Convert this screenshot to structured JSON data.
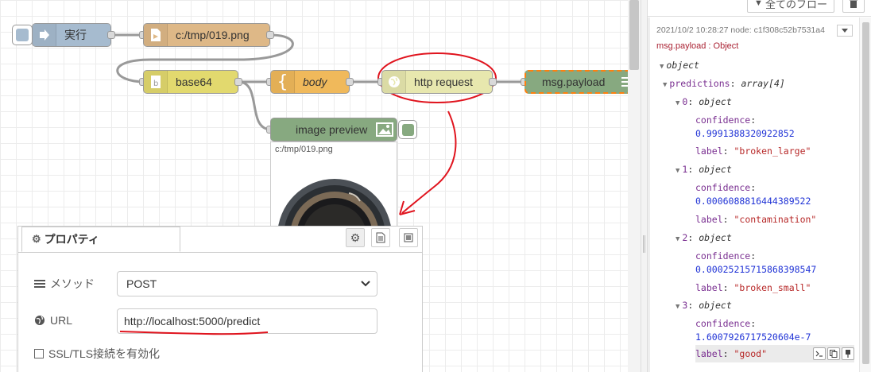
{
  "flow": {
    "inject": {
      "label": "実行"
    },
    "file_in": {
      "label": "c:/tmp/019.png"
    },
    "base64": {
      "label": "base64"
    },
    "template": {
      "label": "body"
    },
    "http": {
      "label": "http request"
    },
    "debug": {
      "label": "msg.payload"
    },
    "preview": {
      "label": "image preview",
      "caption": "c:/tmp/019.png"
    }
  },
  "properties": {
    "tab_title": "プロパティ",
    "method_label": "メソッド",
    "method_value": "POST",
    "url_label": "URL",
    "url_value": "http://localhost:5000/predict",
    "ssl_label": "SSL/TLS接続を有効化"
  },
  "sidebar": {
    "filter_label": "全てのフロー",
    "meta": "2021/10/2 10:28:27   node: c1f308c52b7531a4",
    "topic": "msg.payload : Object",
    "tree": {
      "root": "object",
      "predictions_key": "predictions",
      "predictions_type": "array[4]",
      "items": [
        {
          "index": "0",
          "type": "object",
          "confidence": "0.9991388320922852",
          "label": "\"broken_large\""
        },
        {
          "index": "1",
          "type": "object",
          "confidence": "0.0006088816444389522",
          "label": "\"contamination\""
        },
        {
          "index": "2",
          "type": "object",
          "confidence": "0.00025215715868398547",
          "label": "\"broken_small\""
        },
        {
          "index": "3",
          "type": "object",
          "confidence": "1.6007926717520604e-7",
          "label": "\"good\""
        }
      ],
      "confidence_key": "confidence",
      "label_key": "label"
    }
  },
  "colors": {
    "inject": "#a6bbcf",
    "file": "#deb887",
    "base64": "#e2d96e",
    "template": "#f0b95b",
    "http": "#e7e7ae",
    "debug": "#87a980",
    "annotation": "#e0141e"
  }
}
